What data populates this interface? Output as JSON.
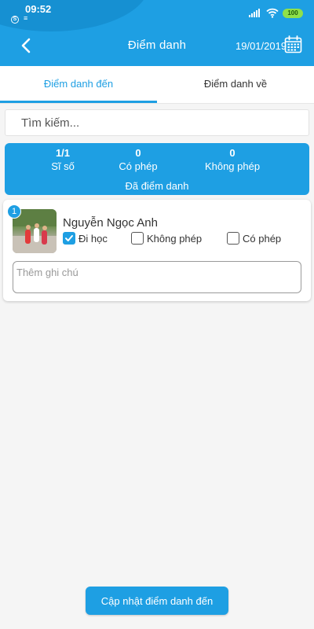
{
  "colors": {
    "primary": "#1e9fe3",
    "background": "#f5f5f5",
    "card": "#ffffff"
  },
  "status_bar": {
    "time": "09:52",
    "battery": "100",
    "icons": [
      "skype-icon",
      "notification-icon",
      "signal-icon",
      "wifi-icon",
      "battery-icon"
    ]
  },
  "header": {
    "title": "Điểm danh",
    "date": "19/01/2019",
    "back_icon": "chevron-left-icon",
    "calendar_icon": "calendar-icon"
  },
  "tabs": [
    {
      "label": "Điểm danh đến",
      "active": true
    },
    {
      "label": "Điểm danh về",
      "active": false
    }
  ],
  "search": {
    "placeholder": "Tìm kiếm..."
  },
  "summary": {
    "stats": [
      {
        "value": "1/1",
        "label": "Sĩ số"
      },
      {
        "value": "0",
        "label": "Có phép"
      },
      {
        "value": "0",
        "label": "Không phép"
      }
    ],
    "status": "Đã điểm danh"
  },
  "students": [
    {
      "index": "1",
      "name": "Nguyễn Ngọc Anh",
      "options": [
        {
          "label": "Đi học",
          "checked": true
        },
        {
          "label": "Không phép",
          "checked": false
        },
        {
          "label": "Có phép",
          "checked": false
        }
      ],
      "note_placeholder": "Thêm ghi chú"
    }
  ],
  "submit": {
    "label": "Cập nhật điểm danh đến"
  }
}
